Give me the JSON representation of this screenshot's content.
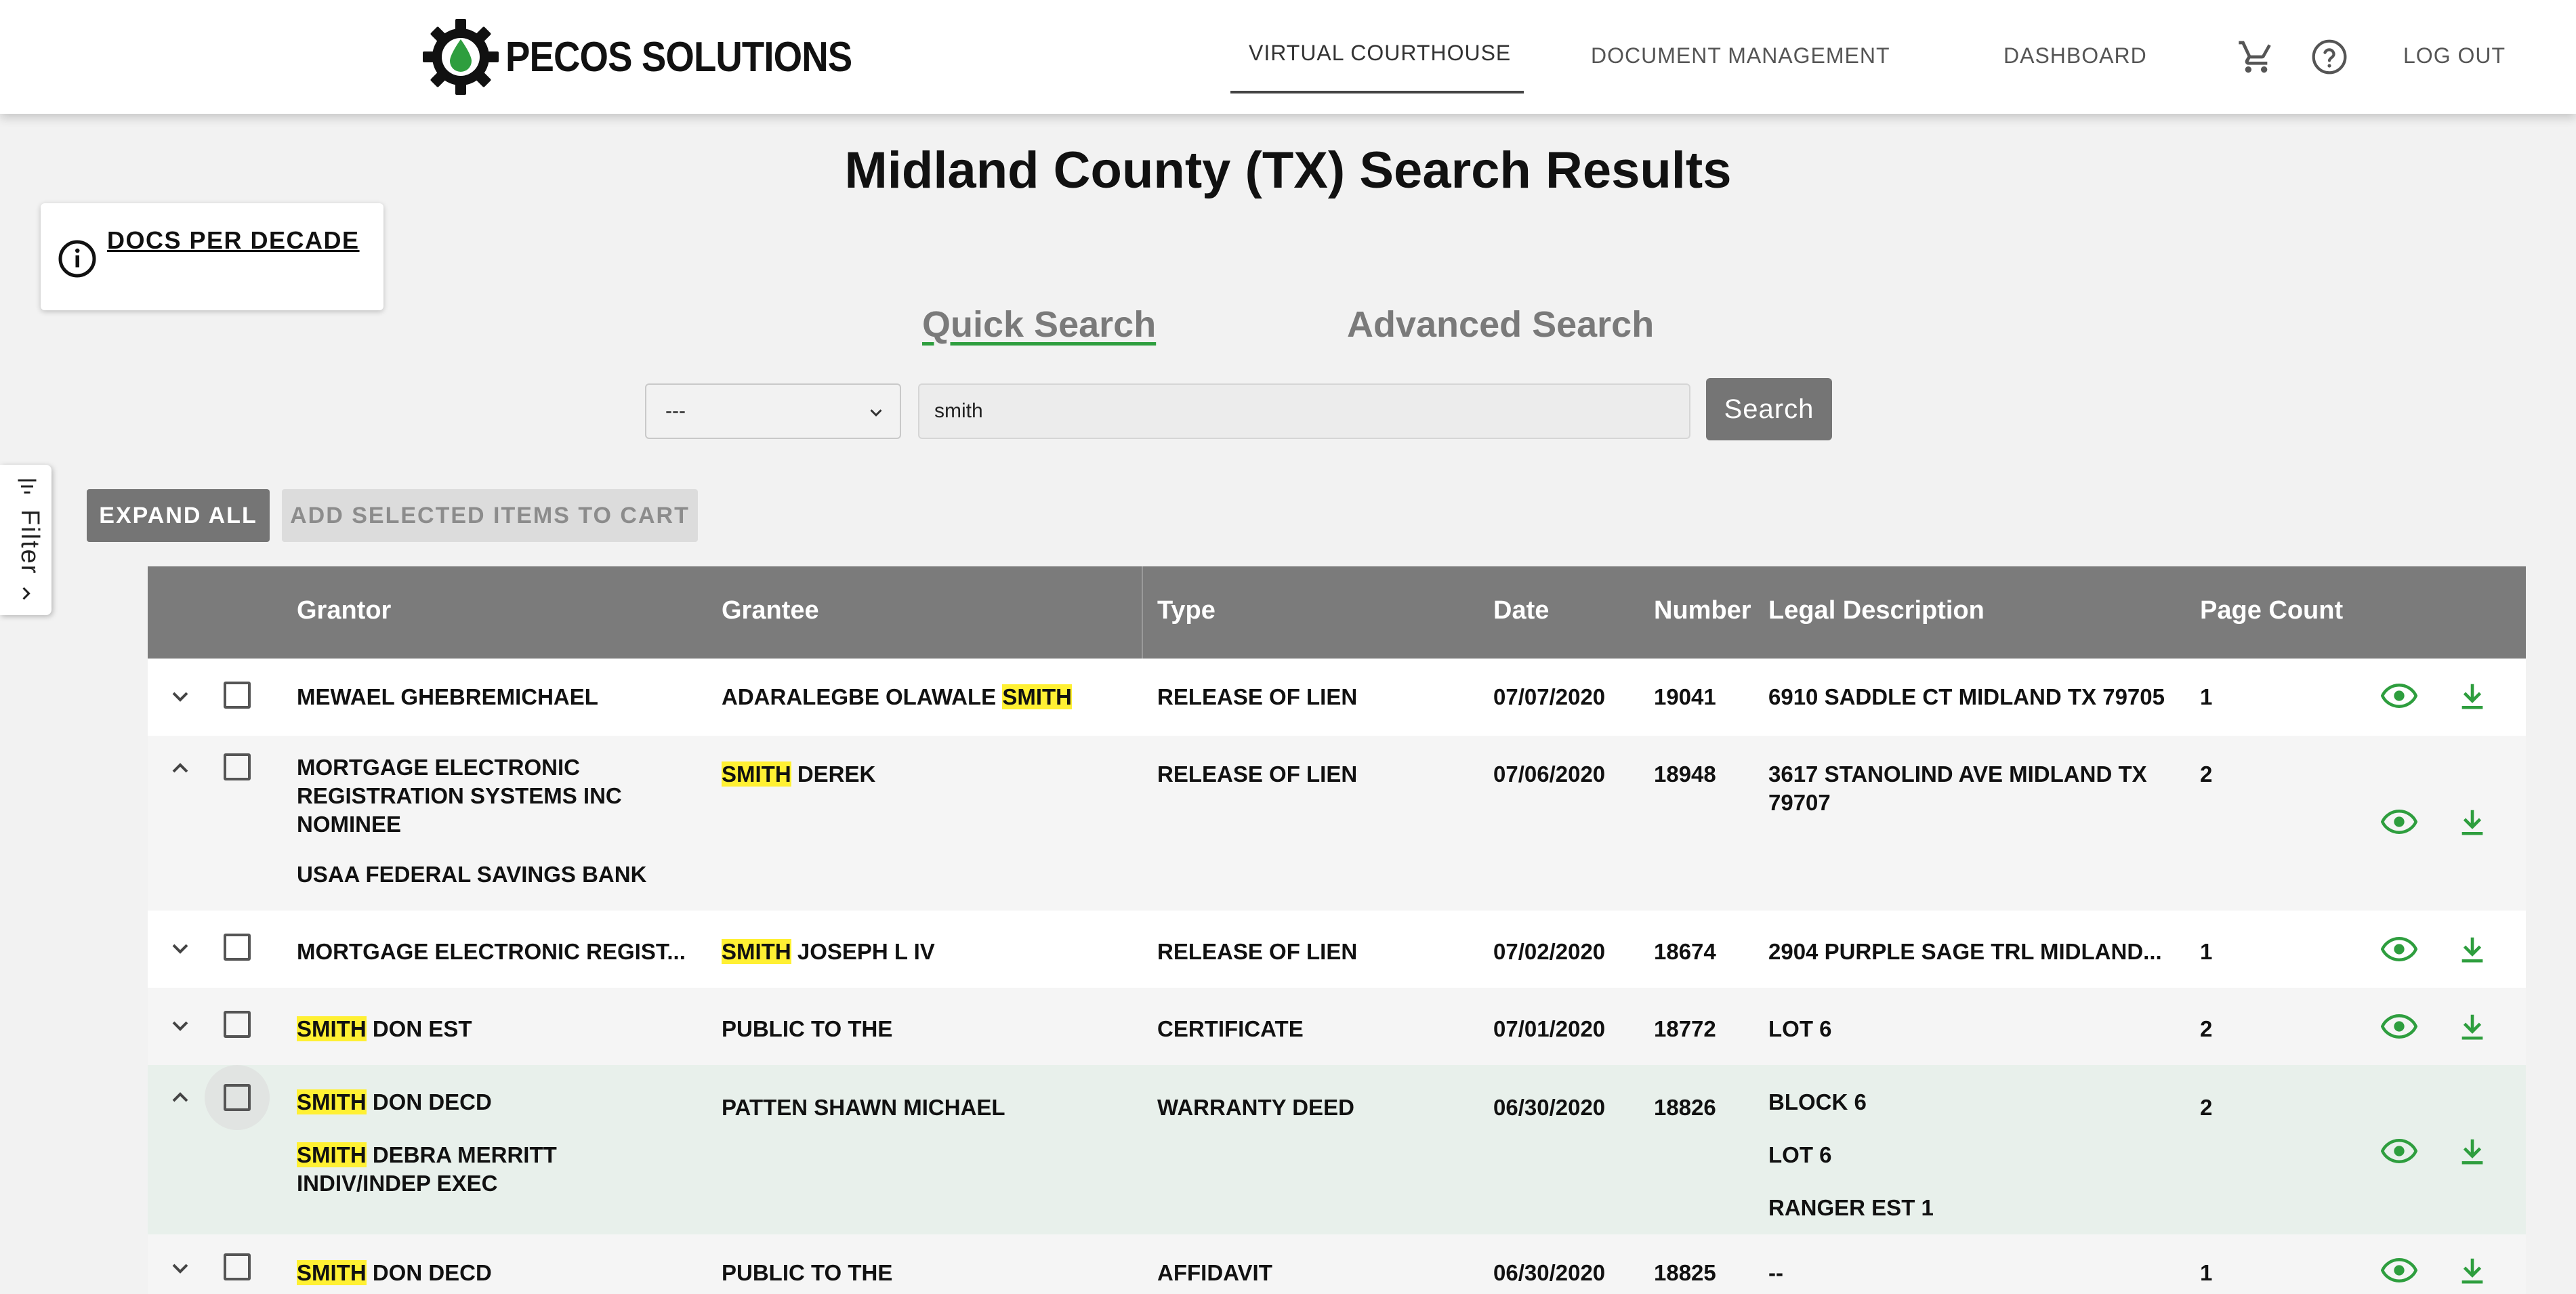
{
  "header": {
    "logo_text": "PECOS SOLUTIONS",
    "nav": {
      "virtual_courthouse": "VIRTUAL COURTHOUSE",
      "document_management": "DOCUMENT MANAGEMENT",
      "dashboard": "DASHBOARD",
      "logout": "LOG OUT"
    },
    "icons": [
      "cart-icon",
      "help-icon"
    ],
    "accent_color": "#2e9e3e"
  },
  "page_title": "Midland County (TX) Search Results",
  "decade_card": {
    "label": "DOCS PER DECADE"
  },
  "search": {
    "tabs": {
      "quick": "Quick Search",
      "advanced": "Advanced Search"
    },
    "select_value": "---",
    "query": "smith",
    "button": "Search"
  },
  "filter": {
    "label": "Filter"
  },
  "actions": {
    "expand_all": "EXPAND ALL",
    "add_to_cart": "ADD SELECTED ITEMS TO CART"
  },
  "table": {
    "columns": [
      "Grantor",
      "Grantee",
      "Type",
      "Date",
      "Number",
      "Legal Description",
      "Page Count"
    ],
    "rows": [
      {
        "grantor": [
          "MEWAEL GHEBREMICHAEL"
        ],
        "grantee_pre": "ADARALEGBE OLAWALE ",
        "grantee_hl": "SMITH",
        "grantee_post": "",
        "type": "RELEASE OF LIEN",
        "date": "07/07/2020",
        "number": "19041",
        "legal": [
          "6910 SADDLE CT MIDLAND TX 79705"
        ],
        "pages": "1",
        "expanded": false
      },
      {
        "grantor_lines": [
          "MORTGAGE ELECTRONIC",
          "REGISTRATION SYSTEMS INC",
          "NOMINEE"
        ],
        "grantor_extra": "USAA FEDERAL SAVINGS BANK",
        "grantee_pre": "",
        "grantee_hl": "SMITH",
        "grantee_post": " DEREK",
        "type": "RELEASE OF LIEN",
        "date": "07/06/2020",
        "number": "18948",
        "legal_lines": [
          "3617 STANOLIND AVE MIDLAND TX",
          "79707"
        ],
        "pages": "2",
        "expanded": true
      },
      {
        "grantor": "MORTGAGE ELECTRONIC REGIST...",
        "grantee_pre": "",
        "grantee_hl": "SMITH",
        "grantee_post": " JOSEPH L IV",
        "type": "RELEASE OF LIEN",
        "date": "07/02/2020",
        "number": "18674",
        "legal": "2904 PURPLE SAGE TRL MIDLAND...",
        "pages": "1",
        "expanded": false
      },
      {
        "grantor_hl": "SMITH",
        "grantor_post": " DON EST",
        "grantee": "PUBLIC TO THE",
        "type": "CERTIFICATE",
        "date": "07/01/2020",
        "number": "18772",
        "legal": "LOT 6",
        "pages": "2",
        "expanded": false
      },
      {
        "grantor_hl": "SMITH",
        "grantor_post": " DON DECD",
        "grantor2_hl": "SMITH",
        "grantor2_post": " DEBRA MERRITT",
        "grantor2_line2": "INDIV/INDEP EXEC",
        "grantee": "PATTEN SHAWN MICHAEL",
        "type": "WARRANTY DEED",
        "date": "06/30/2020",
        "number": "18826",
        "legal_lines": [
          "BLOCK 6",
          "LOT 6",
          "RANGER EST 1"
        ],
        "pages": "2",
        "expanded": true
      },
      {
        "grantor_hl": "SMITH",
        "grantor_post": " DON DECD",
        "grantee": "PUBLIC TO THE",
        "type": "AFFIDAVIT",
        "date": "06/30/2020",
        "number": "18825",
        "legal": "--",
        "pages": "1",
        "expanded": false
      }
    ]
  }
}
